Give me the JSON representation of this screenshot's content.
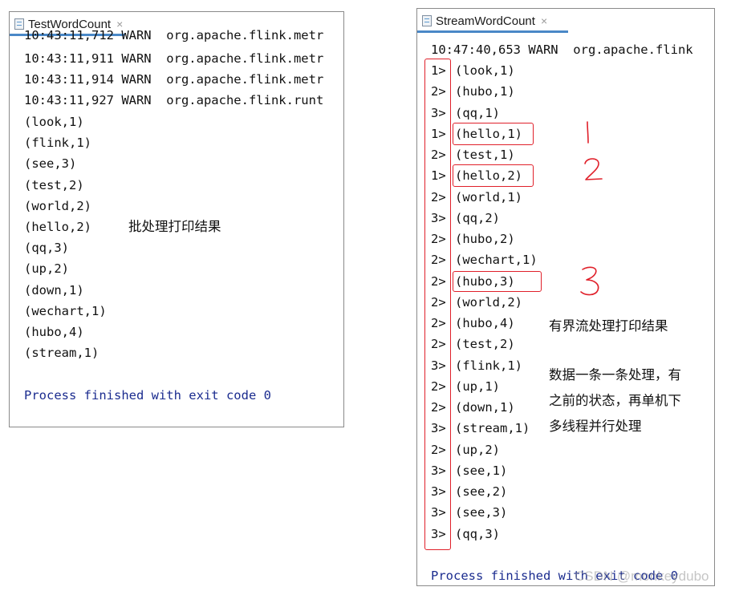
{
  "left_panel": {
    "tab_title": "TestWordCount",
    "tab_close": "×",
    "cut_line": "10:43:11,712 WARN  org.apache.flink.metr",
    "log_lines": [
      "10:43:11,911 WARN  org.apache.flink.metr",
      "10:43:11,914 WARN  org.apache.flink.metr",
      "10:43:11,927 WARN  org.apache.flink.runt"
    ],
    "results": [
      "(look,1)",
      "(flink,1)",
      "(see,3)",
      "(test,2)",
      "(world,2)",
      "(hello,2)",
      "(qq,3)",
      "(up,2)",
      "(down,1)",
      "(wechart,1)",
      "(hubo,4)",
      "(stream,1)"
    ],
    "process_line": "Process finished with exit code 0",
    "annotation": "批处理打印结果"
  },
  "right_panel": {
    "tab_title": "StreamWordCount",
    "tab_close": "×",
    "log_line": "10:47:40,653 WARN  org.apache.flink",
    "results": [
      {
        "prefix": "1>",
        "value": "(look,1)"
      },
      {
        "prefix": "2>",
        "value": "(hubo,1)"
      },
      {
        "prefix": "3>",
        "value": "(qq,1)"
      },
      {
        "prefix": "1>",
        "value": "(hello,1)"
      },
      {
        "prefix": "2>",
        "value": "(test,1)"
      },
      {
        "prefix": "1>",
        "value": "(hello,2)"
      },
      {
        "prefix": "2>",
        "value": "(world,1)"
      },
      {
        "prefix": "3>",
        "value": "(qq,2)"
      },
      {
        "prefix": "2>",
        "value": "(hubo,2)"
      },
      {
        "prefix": "2>",
        "value": "(wechart,1)"
      },
      {
        "prefix": "2>",
        "value": "(hubo,3)"
      },
      {
        "prefix": "2>",
        "value": "(world,2)"
      },
      {
        "prefix": "2>",
        "value": "(hubo,4)"
      },
      {
        "prefix": "2>",
        "value": "(test,2)"
      },
      {
        "prefix": "3>",
        "value": "(flink,1)"
      },
      {
        "prefix": "2>",
        "value": "(up,1)"
      },
      {
        "prefix": "2>",
        "value": "(down,1)"
      },
      {
        "prefix": "3>",
        "value": "(stream,1)"
      },
      {
        "prefix": "2>",
        "value": "(up,2)"
      },
      {
        "prefix": "3>",
        "value": "(see,1)"
      },
      {
        "prefix": "3>",
        "value": "(see,2)"
      },
      {
        "prefix": "3>",
        "value": "(see,3)"
      },
      {
        "prefix": "3>",
        "value": "(qq,3)"
      }
    ],
    "process_line": "Process finished with exit code 0",
    "annotation_title": "有界流处理打印结果",
    "annotation_lines": [
      "数据一条一条处理，有",
      "之前的状态，再单机下",
      "多线程并行处理"
    ],
    "hand_numbers": [
      "1",
      "2",
      "3"
    ]
  },
  "watermark": "CSDN @monkeydubo",
  "colors": {
    "process_text": "#1b2c8f",
    "highlight_red": "#e0202a",
    "tab_underline": "#4a88c7",
    "border": "#8a8a8a"
  }
}
